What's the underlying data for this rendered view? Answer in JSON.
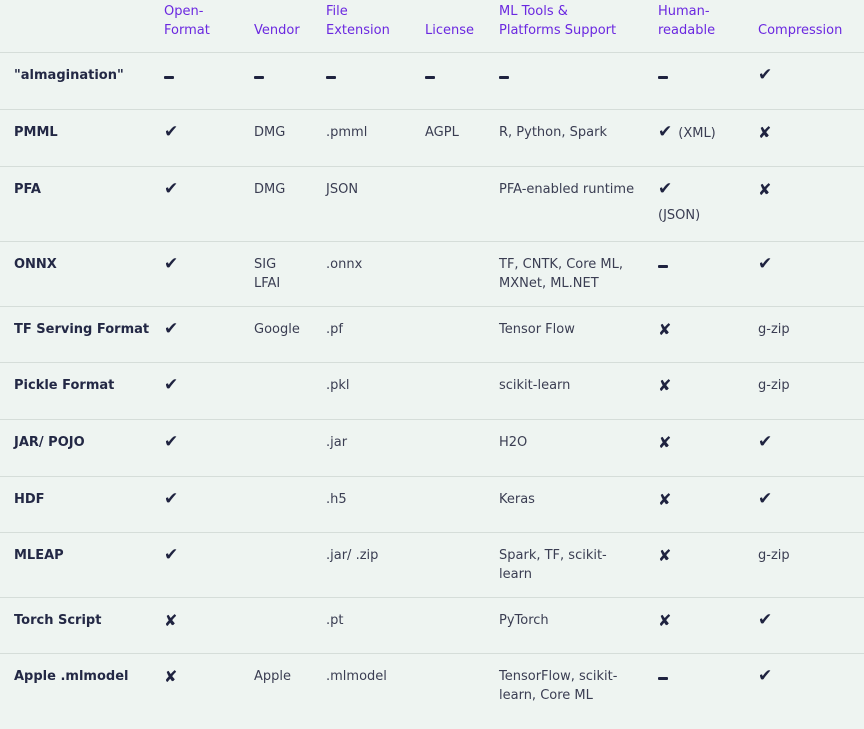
{
  "headers": [
    "",
    "Open-\nFormat",
    "Vendor",
    "File\nExtension",
    "License",
    "ML Tools &\nPlatforms Support",
    "Human-\nreadable",
    "Compression"
  ],
  "rows": [
    {
      "name": "\"almagination\"",
      "open": "dash",
      "vendor": "dash",
      "ext": "dash",
      "license": "dash",
      "tools": "dash",
      "human": "dash",
      "human_note": "",
      "compression": "check",
      "compression_text": ""
    },
    {
      "name": "PMML",
      "open": "check",
      "vendor": "DMG",
      "ext": ".pmml",
      "license": "AGPL",
      "tools": "R, Python, Spark",
      "human": "check",
      "human_note": "(XML)",
      "compression": "cross",
      "compression_text": ""
    },
    {
      "name": "PFA",
      "open": "check",
      "vendor": "DMG",
      "ext": "JSON",
      "license": "",
      "tools": "PFA-enabled runtime",
      "human": "check",
      "human_note": "(JSON)",
      "compression": "cross",
      "compression_text": ""
    },
    {
      "name": "ONNX",
      "open": "check",
      "vendor": "SIG\nLFAI",
      "ext": ".onnx",
      "license": "",
      "tools": "TF, CNTK, Core ML,\nMXNet, ML.NET",
      "human": "dash",
      "human_note": "",
      "compression": "check",
      "compression_text": ""
    },
    {
      "name": "TF Serving Format",
      "open": "check",
      "vendor": "Google",
      "ext": ".pf",
      "license": "",
      "tools": "Tensor Flow",
      "human": "cross",
      "human_note": "",
      "compression": "text",
      "compression_text": "g-zip"
    },
    {
      "name": "Pickle Format",
      "open": "check",
      "vendor": "",
      "ext": ".pkl",
      "license": "",
      "tools": "scikit-learn",
      "human": "cross",
      "human_note": "",
      "compression": "text",
      "compression_text": "g-zip"
    },
    {
      "name": "JAR/ POJO",
      "open": "check",
      "vendor": "",
      "ext": ".jar",
      "license": "",
      "tools": "H2O",
      "human": "cross",
      "human_note": "",
      "compression": "check",
      "compression_text": ""
    },
    {
      "name": "HDF",
      "open": "check",
      "vendor": "",
      "ext": ".h5",
      "license": "",
      "tools": "Keras",
      "human": "cross",
      "human_note": "",
      "compression": "check",
      "compression_text": ""
    },
    {
      "name": "MLEAP",
      "open": "check",
      "vendor": "",
      "ext": ".jar/ .zip",
      "license": "",
      "tools": "Spark, TF, scikit-\nlearn",
      "human": "cross",
      "human_note": "",
      "compression": "text",
      "compression_text": "g-zip"
    },
    {
      "name": "Torch Script",
      "open": "cross",
      "vendor": "",
      "ext": ".pt",
      "license": "",
      "tools": "PyTorch",
      "human": "cross",
      "human_note": "",
      "compression": "check",
      "compression_text": ""
    },
    {
      "name": "Apple .mlmodel",
      "open": "cross",
      "vendor": "Apple",
      "ext": ".mlmodel",
      "license": "",
      "tools": "TensorFlow, scikit-\nlearn, Core ML",
      "human": "dash",
      "human_note": "",
      "compression": "check",
      "compression_text": ""
    }
  ],
  "row_heights": [
    57,
    57,
    75,
    65,
    56,
    57,
    57,
    56,
    65,
    56,
    63
  ]
}
